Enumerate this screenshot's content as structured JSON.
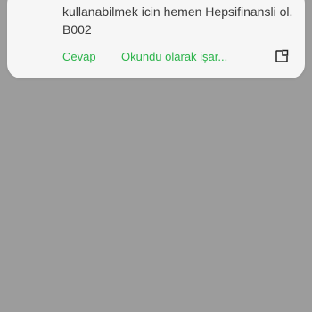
{
  "notification": {
    "body_lines": [
      "kullanabilmek icin hemen Hepsifinansli ol.",
      "B002"
    ],
    "actions": {
      "reply_label": "Cevap",
      "mark_read_label": "Okundu olarak işar..."
    },
    "expand_icon": "open-in-window-icon",
    "accent_color": "#2bb34a"
  },
  "colors": {
    "scrim": "#9c9c9c",
    "card_background": "#f6f6f6",
    "text": "#3a3a3a"
  }
}
